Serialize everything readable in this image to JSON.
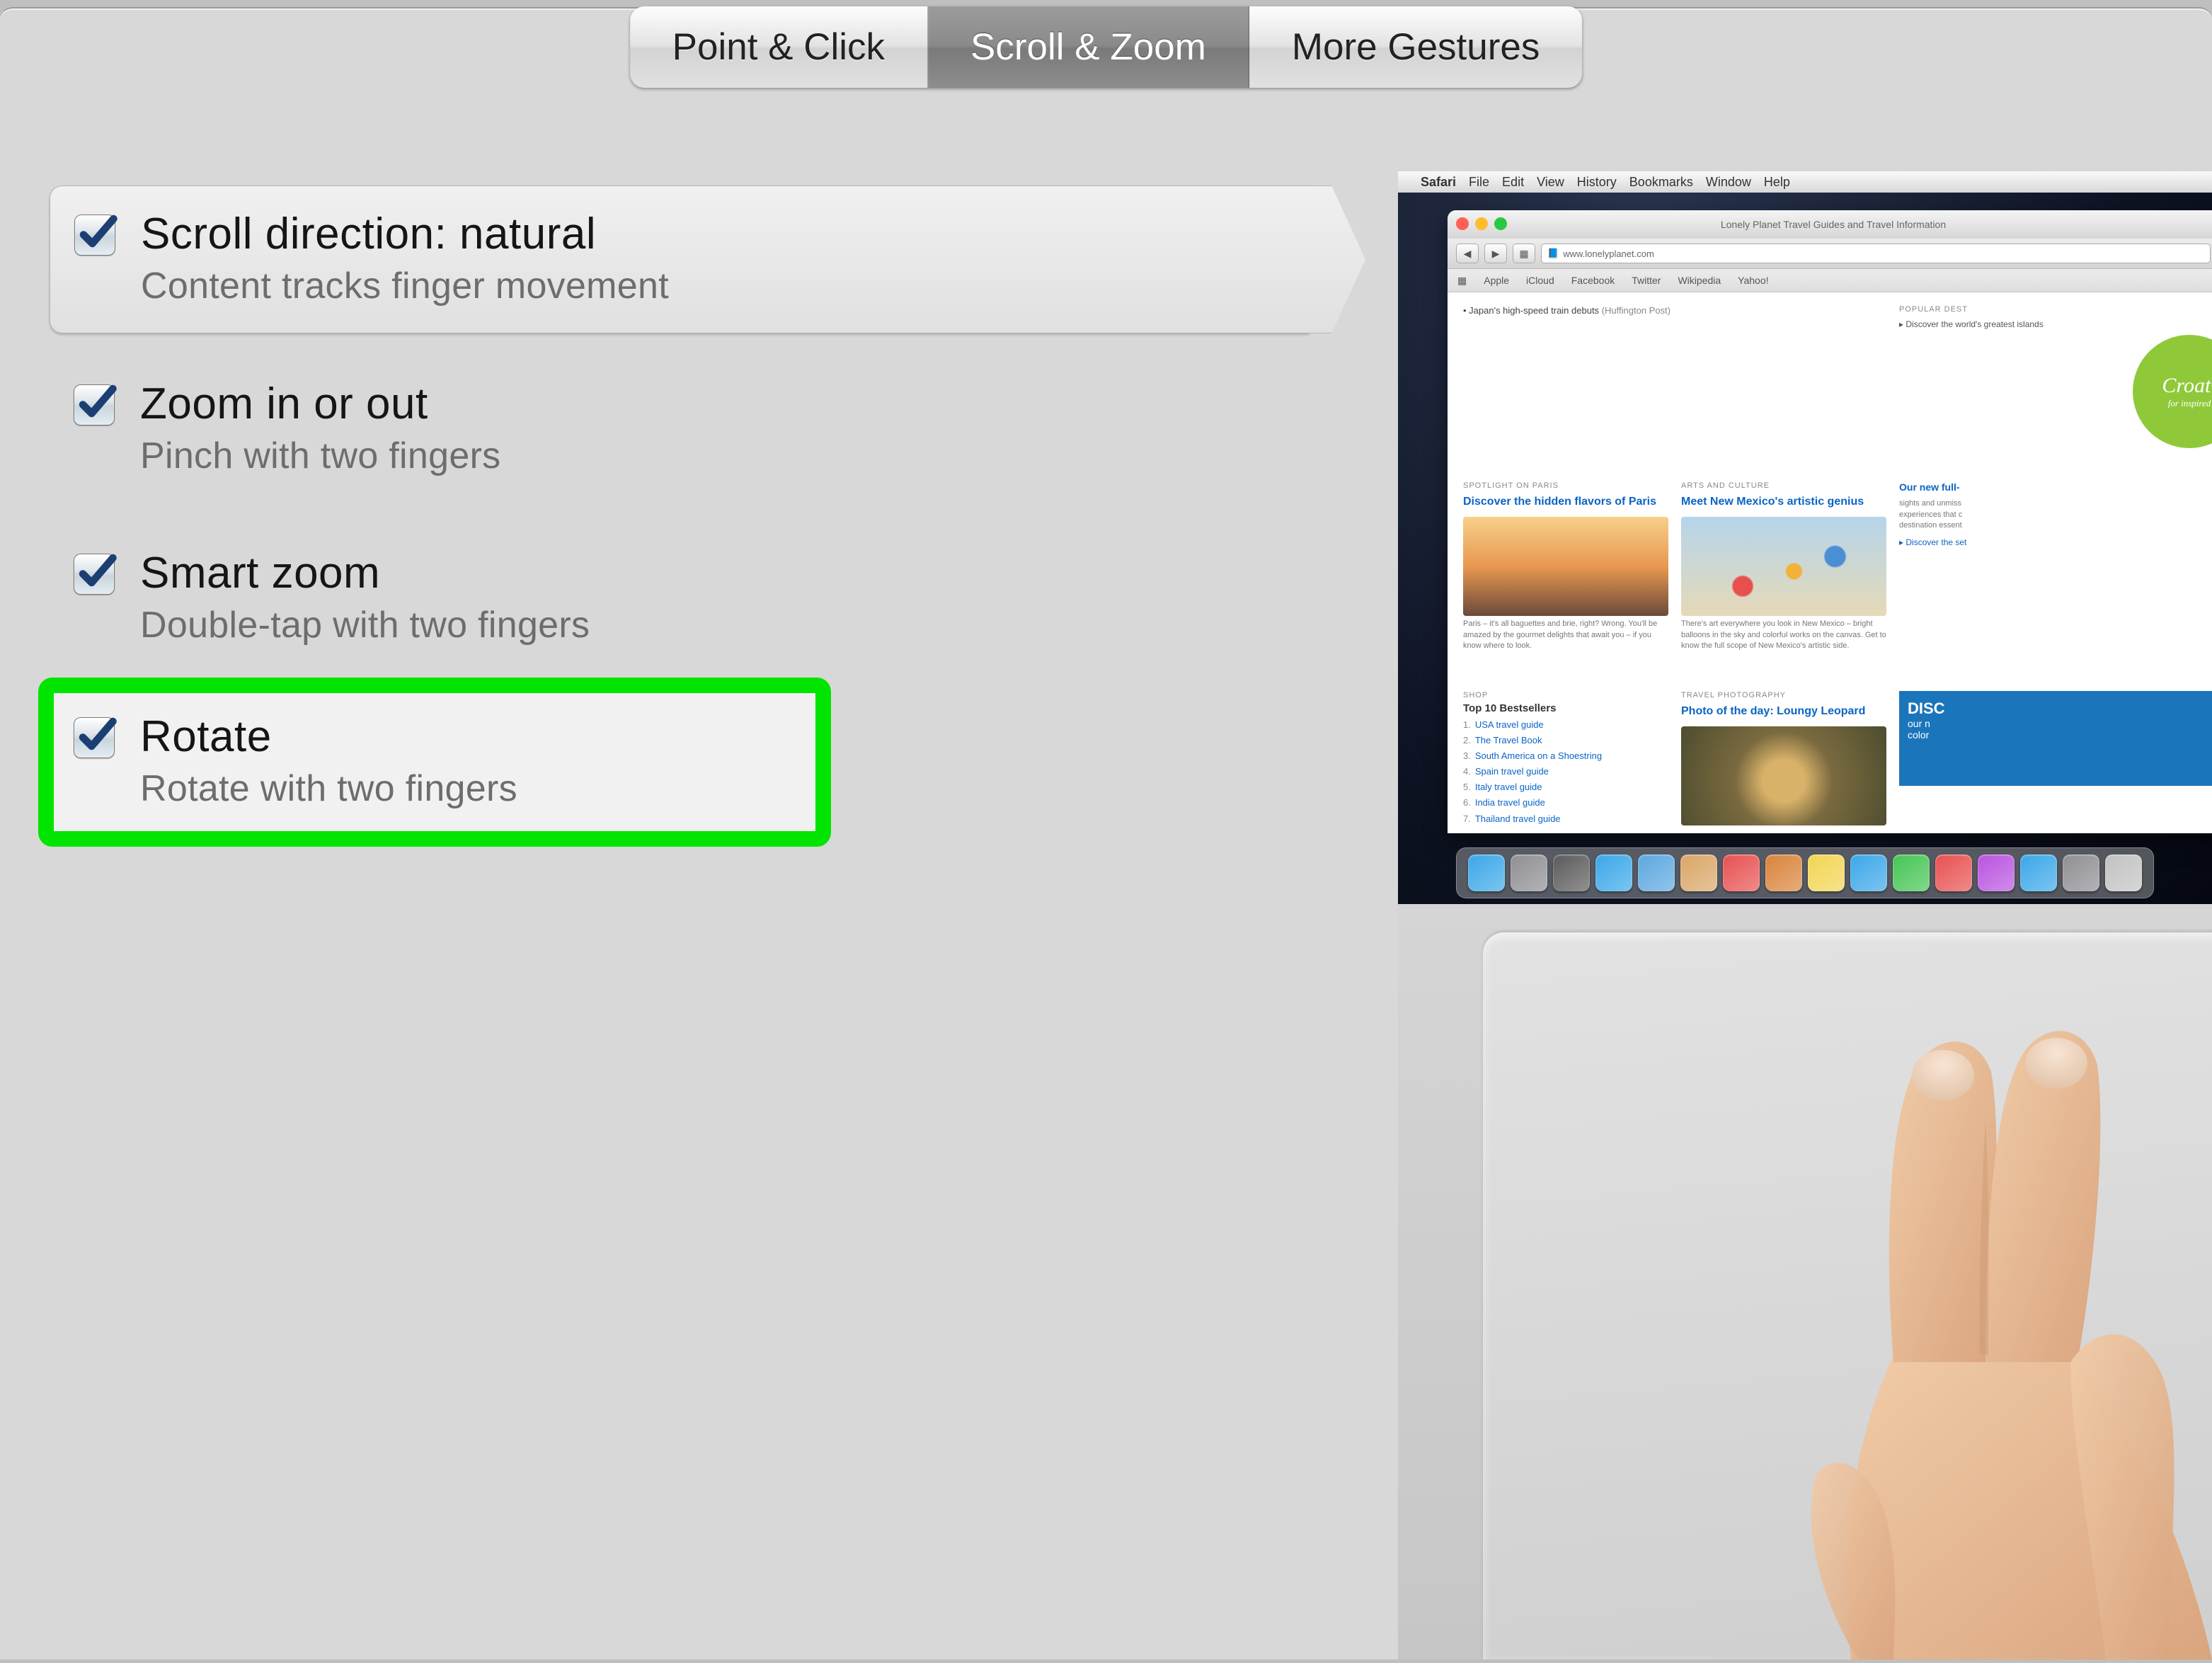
{
  "tabs": {
    "point_click": "Point & Click",
    "scroll_zoom": "Scroll & Zoom",
    "more_gestures": "More Gestures"
  },
  "options": [
    {
      "title": "Scroll direction: natural",
      "desc": "Content tracks finger movement",
      "checked": true,
      "selected": true,
      "highlight": false
    },
    {
      "title": "Zoom in or out",
      "desc": "Pinch with two fingers",
      "checked": true,
      "selected": false,
      "highlight": false
    },
    {
      "title": "Smart zoom",
      "desc": "Double-tap with two fingers",
      "checked": true,
      "selected": false,
      "highlight": false
    },
    {
      "title": "Rotate",
      "desc": "Rotate with two fingers",
      "checked": true,
      "selected": false,
      "highlight": true
    }
  ],
  "menubar": {
    "app": "Safari",
    "items": [
      "File",
      "Edit",
      "View",
      "History",
      "Bookmarks",
      "Window",
      "Help"
    ]
  },
  "safari": {
    "window_title": "Lonely Planet Travel Guides and Travel Information",
    "url": "www.lonelyplanet.com",
    "bookmarks": [
      "Apple",
      "iCloud",
      "Facebook",
      "Twitter",
      "Wikipedia",
      "Yahoo!"
    ],
    "top_left": {
      "text": "Japan's high-speed train debuts",
      "sub": "(Huffington Post)"
    },
    "top_right_hdr": "POPULAR DEST",
    "top_right_item": "Discover the world's greatest islands",
    "badge": "Croati",
    "badge_sub": "for inspired",
    "card1": {
      "hdr": "SPOTLIGHT ON PARIS",
      "lnk": "Discover the hidden flavors of Paris",
      "txt": "Paris – it's all baguettes and brie, right? Wrong. You'll be amazed by the gourmet delights that await you – if you know where to look."
    },
    "card2": {
      "hdr": "ARTS AND CULTURE",
      "lnk": "Meet New Mexico's artistic genius",
      "txt": "There's art everywhere you look in New Mexico – bright balloons in the sky and colorful works on the canvas. Get to know the full scope of New Mexico's artistic side."
    },
    "side_title": "Our new full-",
    "side_txt": "sights and unmiss\nexperiences that c\ndestination essent",
    "side_link": "Discover the set",
    "shop": {
      "hdr": "SHOP",
      "title": "Top 10 Bestsellers",
      "items": [
        "USA travel guide",
        "The Travel Book",
        "South America on a Shoestring",
        "Spain travel guide",
        "Italy travel guide",
        "India travel guide",
        "Thailand travel guide"
      ]
    },
    "photo": {
      "hdr": "TRAVEL PHOTOGRAPHY",
      "lnk": "Photo of the day: Loungy Leopard"
    },
    "disc": {
      "t1": "DISC",
      "t2": "our n",
      "t3": "color"
    }
  },
  "dock_icons": [
    "finder",
    "launchpad",
    "mission",
    "safari",
    "mail",
    "contacts",
    "calendar",
    "reminders",
    "notes",
    "messages",
    "facetime",
    "photobooth",
    "itunes",
    "appstore",
    "settings",
    "trash"
  ],
  "dock_colors": [
    "#3aa7e8",
    "#8e8e93",
    "#5a5a5a",
    "#3aa7e8",
    "#5ba7e0",
    "#d9a666",
    "#e85050",
    "#d9833a",
    "#f2d552",
    "#3aa7e8",
    "#44c553",
    "#e85050",
    "#b953e0",
    "#3aa7e8",
    "#8e8e93",
    "#c2c2c2"
  ]
}
